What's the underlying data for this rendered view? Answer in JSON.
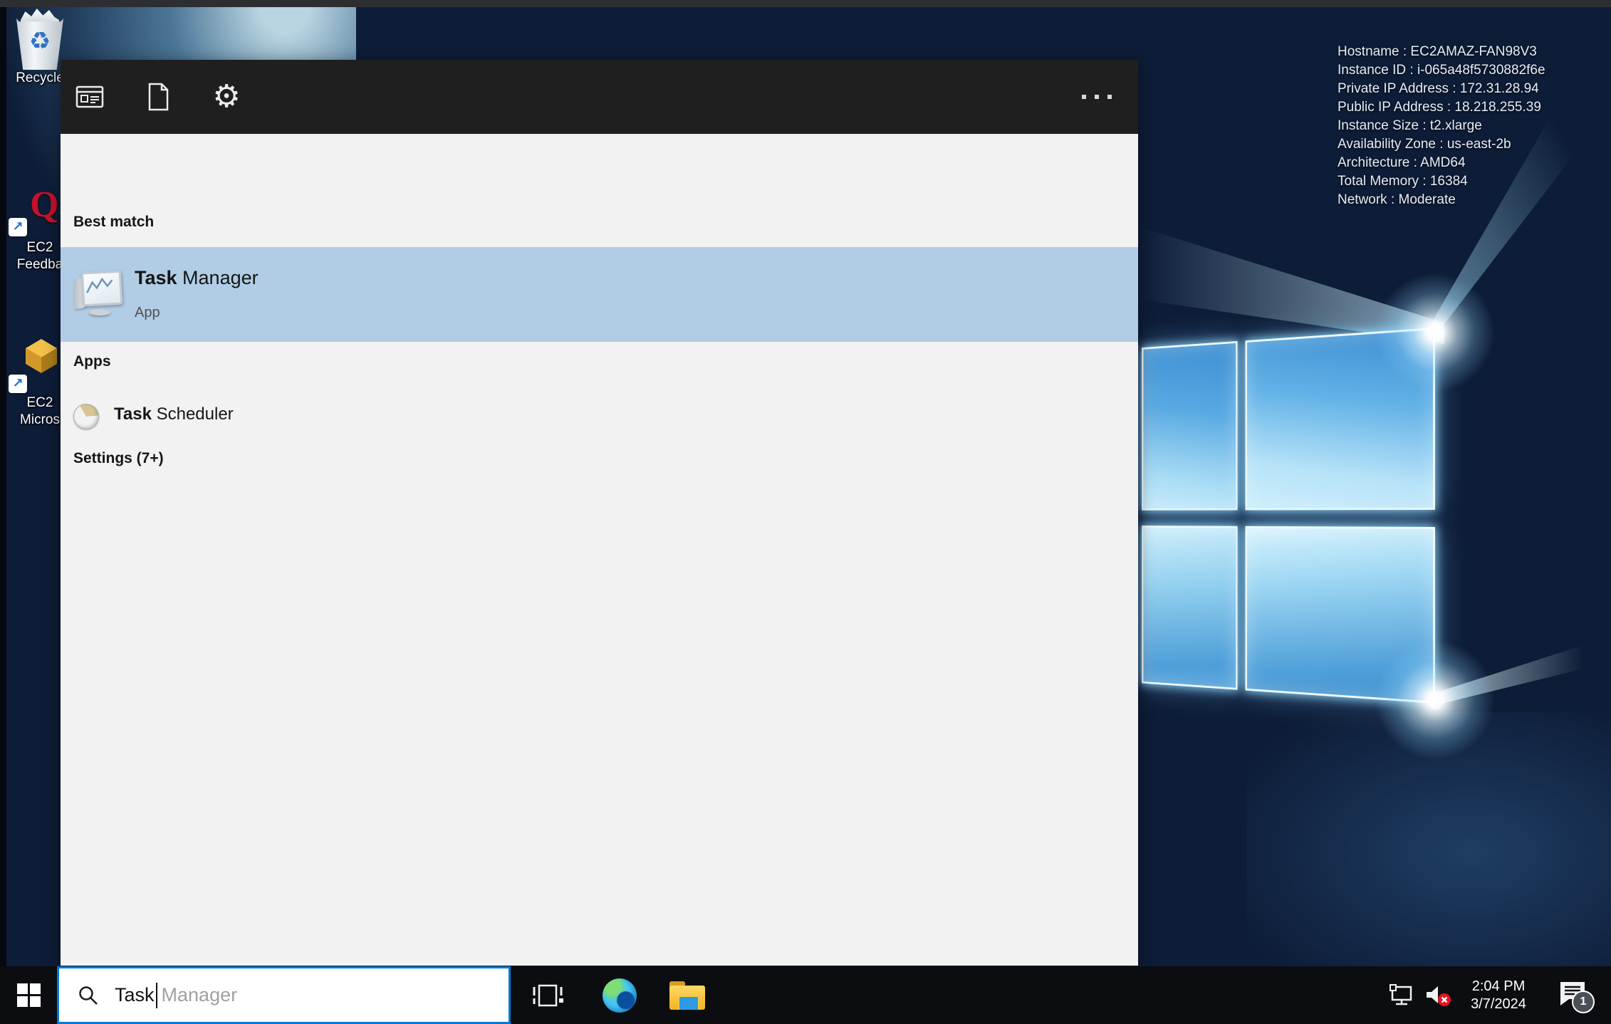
{
  "colors": {
    "accent_blue": "#0078d7",
    "selection_highlight": "#b1cde6",
    "panel_header": "#1f1f1f",
    "panel_body": "#f2f2f2",
    "taskbar": "#0b0d11",
    "wallpaper_base": "#0d1c37"
  },
  "glyphs": {
    "gear": "⚙",
    "recycle": "♻",
    "shortcut_arrow": "↗"
  },
  "desktop": {
    "system_info": [
      "Hostname : EC2AMAZ-FAN98V3",
      "Instance ID : i-065a48f5730882f6e",
      "Private IP Address : 172.31.28.94",
      "Public IP Address : 18.218.255.39",
      "Instance Size : t2.xlarge",
      "Availability Zone : us-east-2b",
      "Architecture : AMD64",
      "Total Memory : 16384",
      "Network : Moderate"
    ],
    "recycle": {
      "label": "Recycle"
    },
    "feedback": {
      "glyph": "Q",
      "line1": "EC2",
      "line2": "Feedba"
    },
    "microsoft": {
      "line1": "EC2",
      "line2": "Micros"
    }
  },
  "search_panel": {
    "best_match": {
      "header": "Best match",
      "match": "Task",
      "rest": " Manager",
      "subtitle": "App"
    },
    "apps": {
      "header": "Apps",
      "match": "Task",
      "rest": " Scheduler"
    },
    "settings": {
      "header": "Settings (7+)"
    }
  },
  "taskbar": {
    "search": {
      "typed": "Task",
      "suggestion": "Manager"
    },
    "clock": {
      "time": "2:04 PM",
      "date": "3/7/2024"
    },
    "badge": "1"
  }
}
